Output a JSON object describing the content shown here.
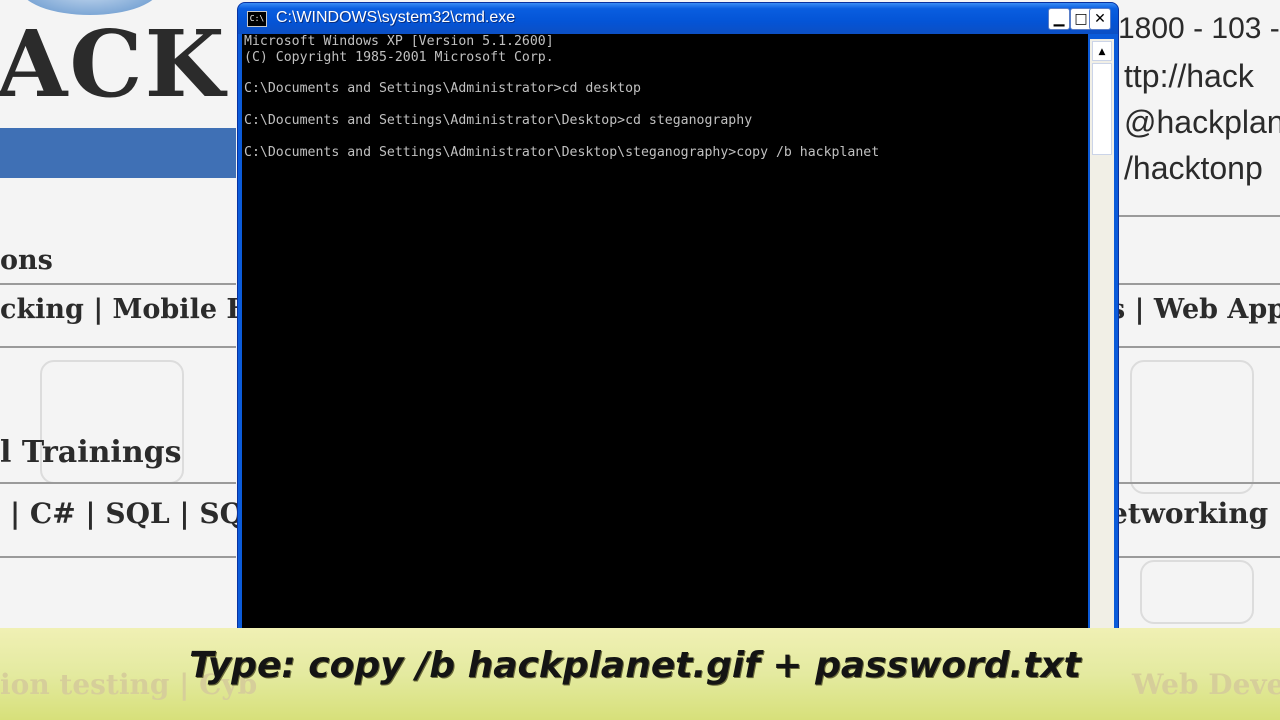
{
  "background": {
    "logo_text": "ACK",
    "left_headings": [
      "ons",
      "cking | Mobile H",
      "l Trainings",
      "| C# | SQL | SQT"
    ],
    "right_lines": [
      "1800 - 103 -",
      "ttp://hack",
      "@hackplan",
      "/hacktonp",
      "s | Web App",
      "etworking |"
    ],
    "band_left": "ion testing | Cyb",
    "band_right": "Web Deve"
  },
  "window": {
    "title": "C:\\WINDOWS\\system32\\cmd.exe",
    "icon_label": "C:\\",
    "controls": {
      "minimize": "▁",
      "maximize": "□",
      "close": "✕"
    }
  },
  "console": {
    "lines": [
      "Microsoft Windows XP [Version 5.1.2600]",
      "(C) Copyright 1985-2001 Microsoft Corp.",
      "",
      "C:\\Documents and Settings\\Administrator>cd desktop",
      "",
      "C:\\Documents and Settings\\Administrator\\Desktop>cd steganography",
      "",
      "C:\\Documents and Settings\\Administrator\\Desktop\\steganography>copy /b hackplanet"
    ]
  },
  "caption": "Type: copy /b hackplanet.gif + password.txt"
}
